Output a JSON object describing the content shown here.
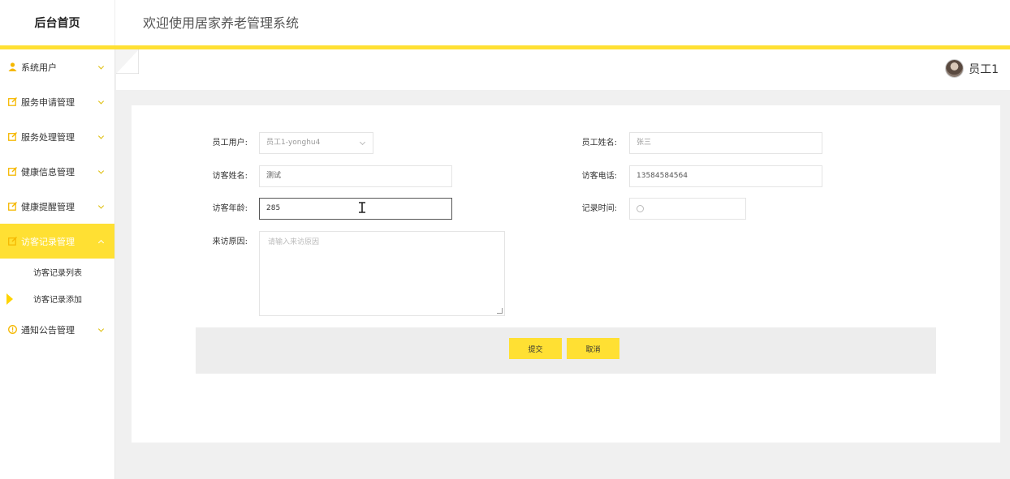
{
  "header": {
    "logo": "后台首页",
    "welcome": "欢迎使用居家养老管理系统"
  },
  "user": {
    "name": "员工1"
  },
  "sidebar": {
    "items": [
      {
        "label": "系统用户",
        "icon": "user-icon"
      },
      {
        "label": "服务申请管理",
        "icon": "edit-icon"
      },
      {
        "label": "服务处理管理",
        "icon": "edit-icon"
      },
      {
        "label": "健康信息管理",
        "icon": "edit-icon"
      },
      {
        "label": "健康提醒管理",
        "icon": "edit-icon"
      },
      {
        "label": "访客记录管理",
        "icon": "edit-icon"
      },
      {
        "label": "通知公告管理",
        "icon": "info-icon"
      }
    ],
    "submenu": [
      {
        "label": "访客记录列表"
      },
      {
        "label": "访客记录添加"
      }
    ]
  },
  "form": {
    "employee_user": {
      "label": "员工用户:",
      "value": "员工1-yonghu4"
    },
    "employee_name": {
      "label": "员工姓名:",
      "value": "张三"
    },
    "visitor_name": {
      "label": "访客姓名:",
      "value": "测试"
    },
    "visitor_phone": {
      "label": "访客电话:",
      "value": "13584584564"
    },
    "visitor_age": {
      "label": "访客年龄:",
      "value": "285"
    },
    "record_time": {
      "label": "记录时间:",
      "value": ""
    },
    "visit_reason": {
      "label": "来访原因:",
      "placeholder": "请输入来访原因"
    }
  },
  "buttons": {
    "submit": "提交",
    "cancel": "取消"
  },
  "colors": {
    "accent": "#ffe033",
    "sidebar_active": "#ffe033"
  }
}
